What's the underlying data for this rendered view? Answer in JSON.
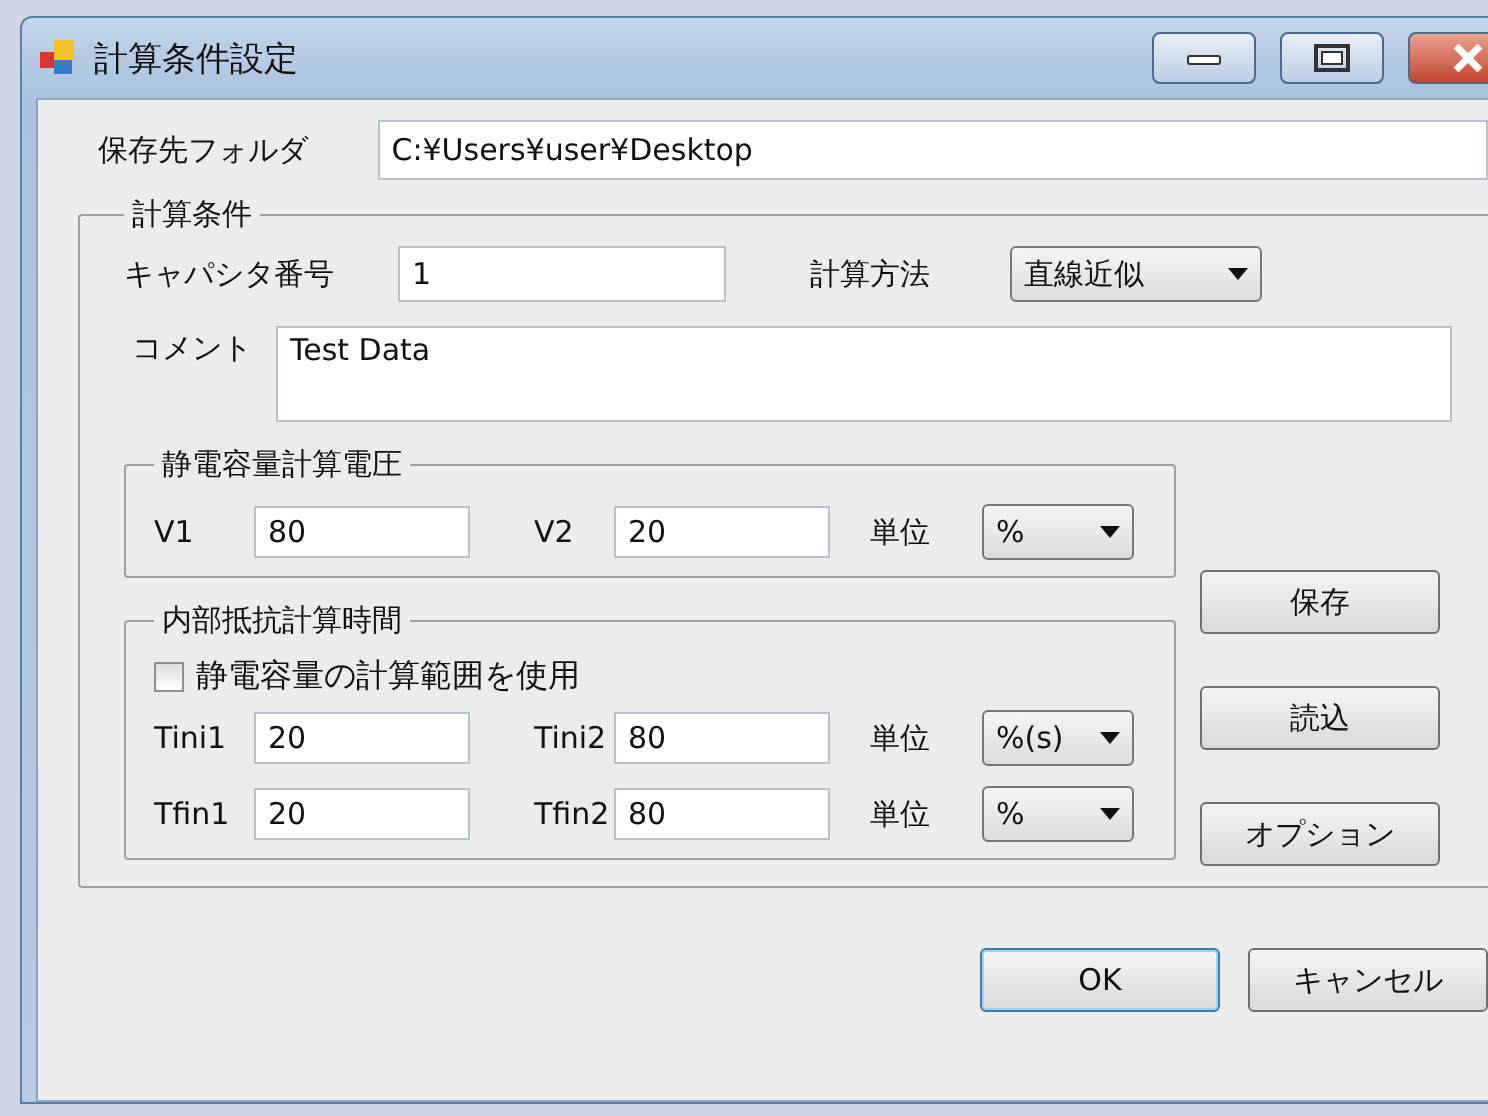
{
  "window": {
    "title": "計算条件設定"
  },
  "save_folder": {
    "label": "保存先フォルダ",
    "value": "C:¥Users¥user¥Desktop"
  },
  "group": {
    "title": "計算条件",
    "capacitor_number": {
      "label": "キャパシタ番号",
      "value": "1"
    },
    "method": {
      "label": "計算方法",
      "value": "直線近似"
    },
    "comment": {
      "label": "コメント",
      "value": "Test Data"
    },
    "voltage_group": {
      "title": "静電容量計算電圧",
      "rows": [
        {
          "fields": [
            {
              "label": "V1",
              "value": "80"
            },
            {
              "label": "V2",
              "value": "20"
            }
          ],
          "unit": {
            "label": "単位",
            "value": "%"
          }
        }
      ]
    },
    "time_group": {
      "title": "内部抵抗計算時間",
      "checkbox": {
        "label": "静電容量の計算範囲を使用",
        "checked": false
      },
      "rows": [
        {
          "fields": [
            {
              "label": "Tini1",
              "value": "20"
            },
            {
              "label": "Tini2",
              "value": "80"
            }
          ],
          "unit": {
            "label": "単位",
            "value": "%(s)"
          }
        },
        {
          "fields": [
            {
              "label": "Tfin1",
              "value": "20"
            },
            {
              "label": "Tfin2",
              "value": "80"
            }
          ],
          "unit": {
            "label": "単位",
            "value": "%"
          }
        }
      ]
    },
    "side_buttons": [
      "保存",
      "読込",
      "オプション"
    ]
  },
  "buttons": [
    {
      "label": "OK",
      "default": true
    },
    {
      "label": "キャンセル",
      "default": false
    }
  ]
}
